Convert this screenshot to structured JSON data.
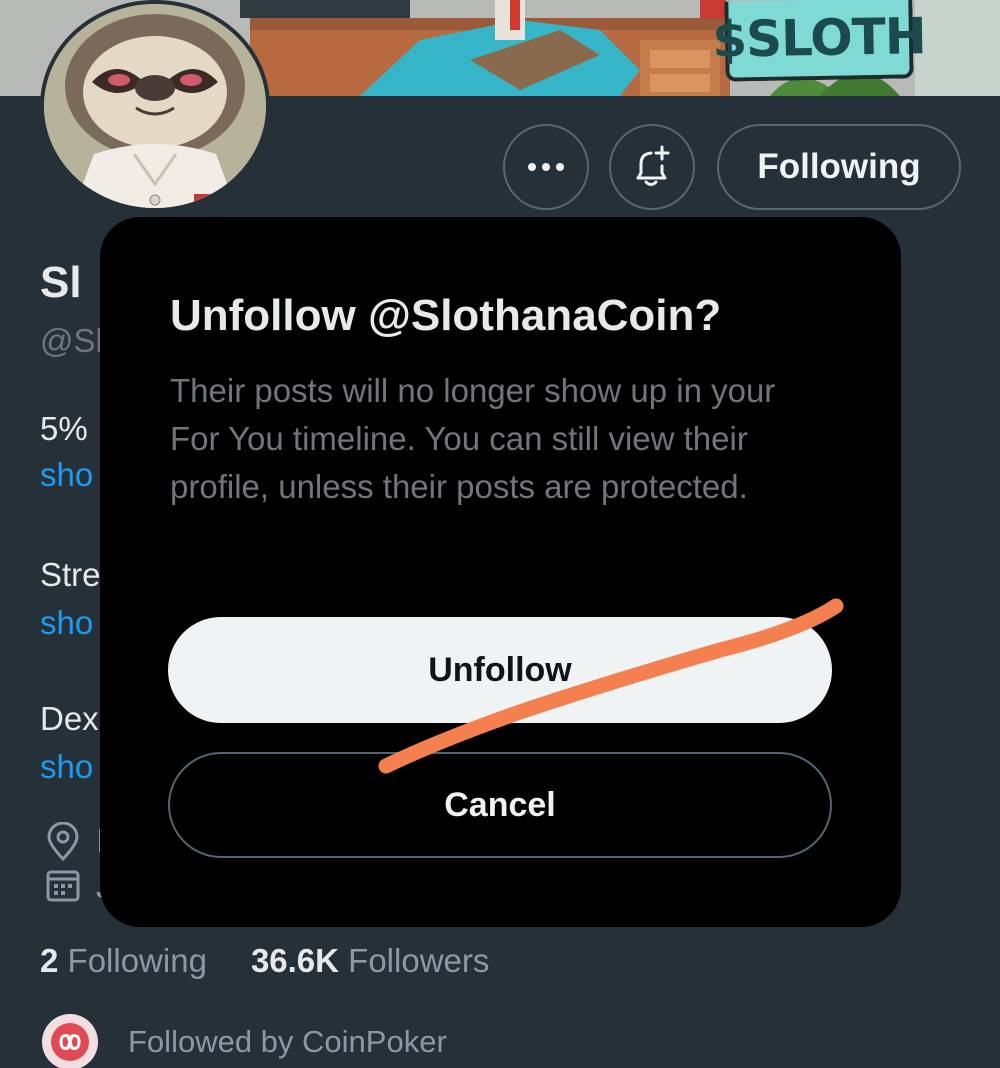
{
  "banner": {
    "tag_text": "$SLOTH"
  },
  "profile": {
    "name_partial": "Sl",
    "handle_partial": "@Sl",
    "bio_lines": [
      {
        "text": "5%",
        "link": "sho"
      },
      {
        "text": "Stre",
        "link": "sho"
      },
      {
        "text": "Dex",
        "link": "sho"
      }
    ],
    "location_partial": "I",
    "joined_partial": "J",
    "following_count": "2",
    "following_label": "Following",
    "followers_count": "36.6K",
    "followers_label": "Followers",
    "followed_by_text": "Followed by CoinPoker"
  },
  "actions": {
    "following_button_label": "Following"
  },
  "dialog": {
    "title": "Unfollow @SlothanaCoin?",
    "body": "Their posts will no longer show up in your For You timeline. You can still view their profile, unless their posts are protected.",
    "confirm_label": "Unfollow",
    "cancel_label": "Cancel"
  },
  "colors": {
    "background": "#263038",
    "modal": "#000000",
    "link": "#1d9bf0",
    "annotation": "#f5804f"
  }
}
